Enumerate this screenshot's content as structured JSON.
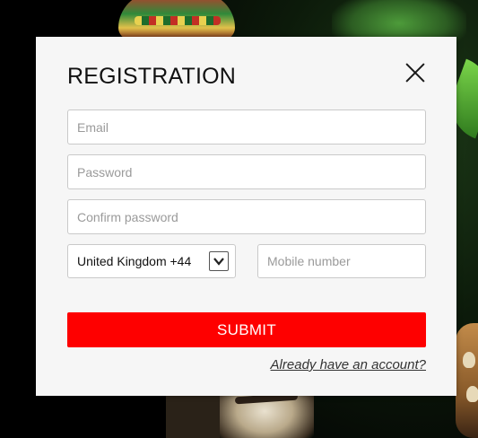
{
  "modal": {
    "title": "REGISTRATION",
    "close_icon": "close-icon",
    "email": {
      "placeholder": "Email",
      "value": ""
    },
    "password": {
      "placeholder": "Password",
      "value": ""
    },
    "confirm_password": {
      "placeholder": "Confirm password",
      "value": ""
    },
    "country": {
      "selected": "United Kingdom +44",
      "icon": "chevron-down-icon"
    },
    "mobile": {
      "placeholder": "Mobile number",
      "value": ""
    },
    "submit_label": "SUBMIT",
    "login_link": "Already have an account?"
  },
  "colors": {
    "submit_bg": "#fe0000",
    "modal_bg": "#f6f6f6",
    "page_bg": "#0a0a08"
  }
}
